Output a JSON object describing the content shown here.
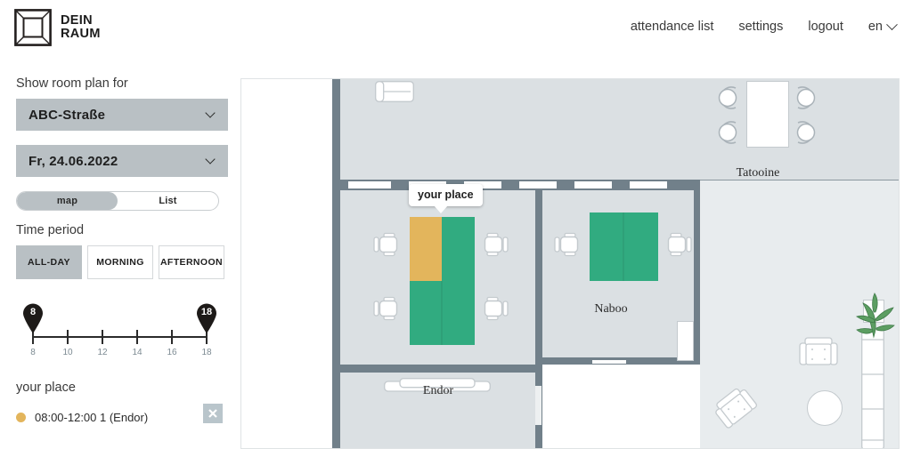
{
  "brand": {
    "line1": "DEIN",
    "line2": "RAUM",
    "logo_icon": "room-box-logo-icon"
  },
  "nav": {
    "items": [
      {
        "label": "attendance list",
        "name": "nav-attendance-list"
      },
      {
        "label": "settings",
        "name": "nav-settings"
      },
      {
        "label": "logout",
        "name": "nav-logout"
      }
    ],
    "language": "en",
    "language_chevron_icon": "chevron-down-icon"
  },
  "sidebar": {
    "show_room_plan_label": "Show room plan for",
    "location_select": {
      "value": "ABC-Straße",
      "chevron_icon": "chevron-down-icon"
    },
    "date_select": {
      "value": "Fr, 24.06.2022",
      "chevron_icon": "chevron-down-icon"
    },
    "view_toggle": {
      "options": [
        "map",
        "List"
      ],
      "selected": "map"
    },
    "time_period": {
      "label": "Time period",
      "options": [
        "ALL-DAY",
        "MORNING",
        "AFTERNOON"
      ],
      "selected": "ALL-DAY"
    },
    "slider": {
      "min": 8,
      "max": 18,
      "handle_low": "8",
      "handle_high": "18",
      "tick_labels": [
        "8",
        "10",
        "12",
        "14",
        "16",
        "18"
      ]
    },
    "your_place": {
      "title": "your place",
      "entries": [
        {
          "dot_color": "#e3b55c",
          "text": "08:00-12:00 1 (Endor)",
          "delete_icon": "close-icon"
        }
      ]
    }
  },
  "map": {
    "tooltip": "your place",
    "rooms": [
      {
        "name": "Endor"
      },
      {
        "name": "Naboo"
      },
      {
        "name": "Tatooine"
      }
    ],
    "room_labels": {
      "endor": "Endor",
      "naboo": "Naboo",
      "tatooine": "Tatooine"
    },
    "colors": {
      "desk_available": "#31ab80",
      "desk_yours": "#e3b55c",
      "wall": "#71808a",
      "floor": "#dbe0e3",
      "floor_open": "#e8ecee"
    },
    "desks": {
      "endor": [
        "yours",
        "available",
        "available",
        "available"
      ],
      "naboo": [
        "available",
        "available"
      ]
    }
  }
}
